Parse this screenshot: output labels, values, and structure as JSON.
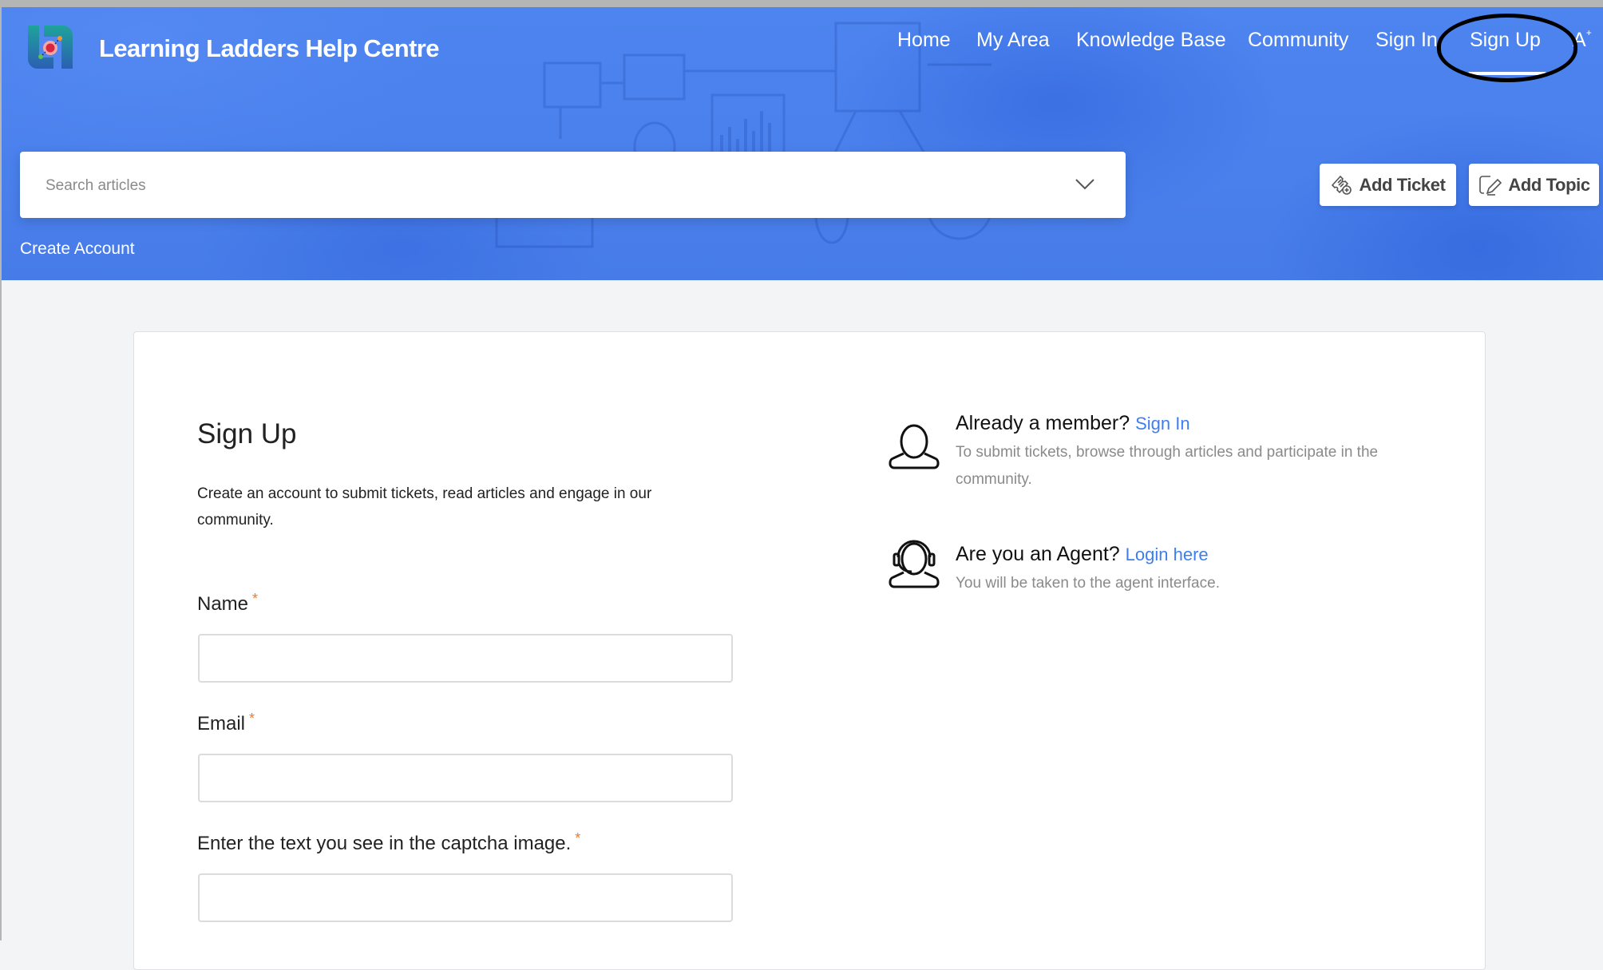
{
  "header": {
    "site_title": "Learning Ladders Help Centre",
    "logo": "learning-ladders-logo",
    "nav": [
      {
        "label": "Home"
      },
      {
        "label": "My Area"
      },
      {
        "label": "Knowledge Base"
      },
      {
        "label": "Community"
      },
      {
        "label": "Sign In"
      },
      {
        "label": "Sign Up",
        "active": true
      }
    ],
    "font_size_toggle": "A",
    "font_size_toggle_sup": "+",
    "search": {
      "placeholder": "Search articles",
      "value": ""
    },
    "breadcrumb": "Create Account",
    "buttons": {
      "add_ticket": {
        "label": "Add Ticket",
        "icon": "ticket-add-icon"
      },
      "add_topic": {
        "label": "Add Topic",
        "icon": "edit-topic-icon"
      }
    }
  },
  "signup": {
    "title": "Sign Up",
    "description": "Create an account to submit tickets, read articles and engage in our community.",
    "required_marker": "*",
    "fields": [
      {
        "label": "Name",
        "value": "",
        "required": true
      },
      {
        "label": "Email",
        "value": "",
        "required": true
      },
      {
        "label": "Enter the text you see in the captcha image.",
        "value": "",
        "required": true
      }
    ]
  },
  "side": {
    "member": {
      "title": "Already a member?",
      "link": "Sign In",
      "description": "To submit tickets, browse through articles and participate in the community.",
      "icon": "user-icon"
    },
    "agent": {
      "title": "Are you an Agent?",
      "link": "Login here",
      "description": "You will be taken to the agent interface.",
      "icon": "agent-headset-icon"
    }
  },
  "colors": {
    "header_blue": "#4a80ee",
    "link_blue": "#3d7ef1",
    "required_orange": "#f0772f",
    "page_bg": "#f3f4f6"
  }
}
